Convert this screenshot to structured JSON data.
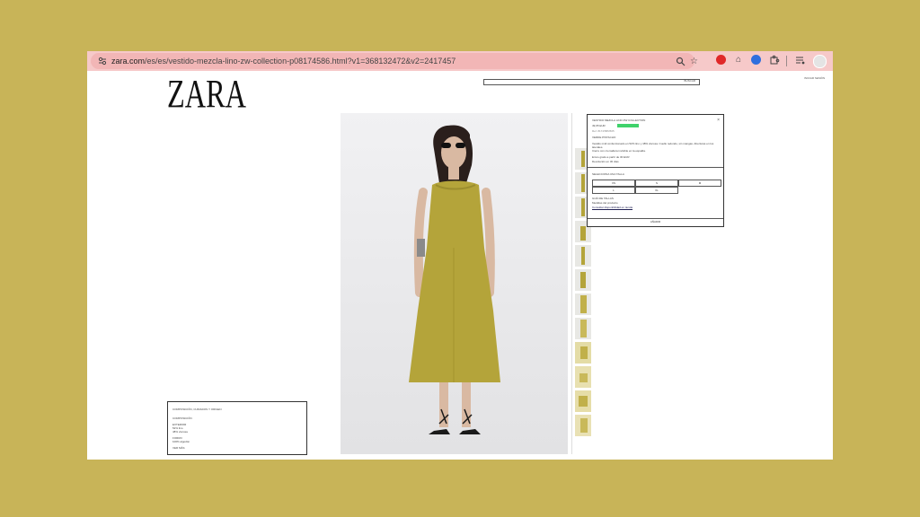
{
  "browser": {
    "url_domain": "zara.com",
    "url_path": "/es/es/vestido-mezcla-lino-zw-collection-p08174586.html?v1=368132472&v2=2417457",
    "icons": {
      "site": "tune-icon",
      "zoom": "zoom-icon",
      "bookmark": "star-icon",
      "extensions": "puzzle-icon",
      "media": "media-control-icon",
      "profile": "avatar-icon"
    },
    "colors": {
      "bar": "#f6c9c9",
      "pill": "#f2b6b6",
      "ext_red": "#e02828",
      "ext_blue": "#2f6fde"
    }
  },
  "header": {
    "logo": "ZARA",
    "search_label": "BUSCAR",
    "top_links": "INICIAR SESIÓN"
  },
  "product": {
    "name": "VESTIDO MEZCLA LINO ZW COLLECTION",
    "price": "49,95 EUR",
    "badge_color": "#3fd26b",
    "ref": "Ref. 8174/586/505",
    "color_label": "VERDE PISTACHO",
    "description_1": "Vestido midi confeccionado en 52% lino y 48% viscosa. Cuello redondo, sin mangas. Aberturas en los laterales.",
    "description_2": "Cierre con cremallera invisible en la espalda.",
    "status_1": "Envío gratis a partir de 30 EUR",
    "status_2": "Devolución en 30 días",
    "size_prompt": "SELECCIONA UNA TALLA",
    "sizes": [
      "XS",
      "S",
      "M",
      "L",
      "XL"
    ],
    "size_guide": "GUÍA DE TALLAS",
    "measurements": "Medidas del producto",
    "availability": "Consultar disponibilidad en tienda",
    "add_button": "AÑADIR",
    "close_symbol": "×"
  },
  "composition": {
    "heading": "COMPOSICIÓN, CUIDADOS Y ORIGEN",
    "sub": "COMPOSICIÓN",
    "section_1": "EXTERIOR",
    "line_1": "52% lino",
    "line_2": "48% viscosa",
    "section_2": "FORRO",
    "line_3": "100% algodón",
    "more": "VER MÁS"
  },
  "dress_color": "#b4a43a"
}
